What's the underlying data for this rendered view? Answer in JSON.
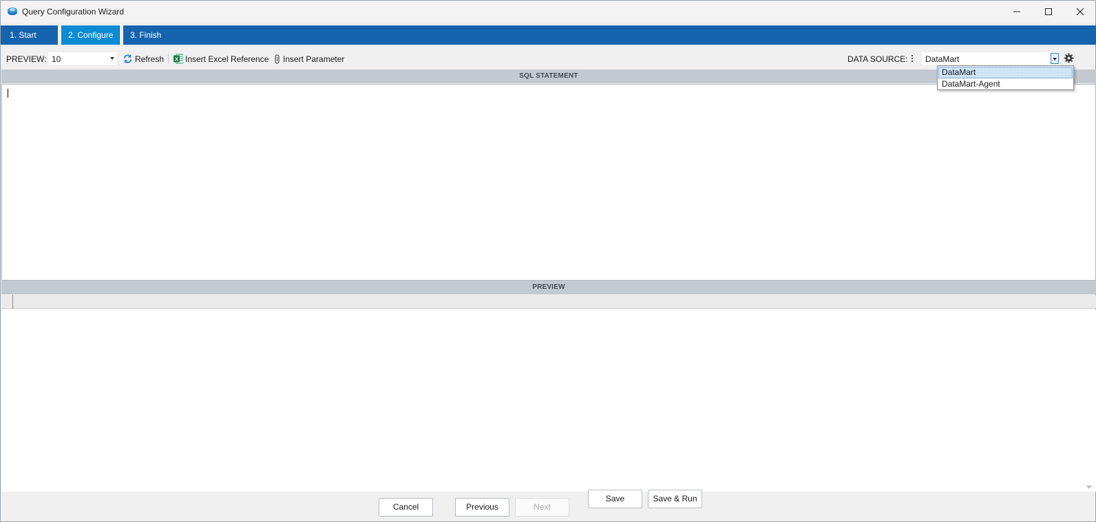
{
  "window": {
    "title": "Query Configuration Wizard",
    "icon": "app-logo-icon"
  },
  "wizard": {
    "steps": [
      {
        "label": "1. Start",
        "active": false
      },
      {
        "label": "2. Configure",
        "active": true
      },
      {
        "label": "3. Finish",
        "active": false
      }
    ],
    "colors": {
      "bar": "#1663ae",
      "active": "#0c8cd3"
    }
  },
  "toolbar": {
    "preview_label": "PREVIEW:",
    "preview_value": "10",
    "refresh_label": "Refresh",
    "insert_excel_label": "Insert Excel Reference",
    "insert_parameter_label": "Insert Parameter",
    "data_source_label": "DATA SOURCE:",
    "data_source_value": "DataMart"
  },
  "data_source_dropdown": {
    "options": [
      "DataMart",
      "DataMart-Agent"
    ],
    "selected": "DataMart"
  },
  "sections": {
    "sql_header": "SQL STATEMENT",
    "sql_text": "",
    "preview_header": "PREVIEW"
  },
  "footer": {
    "cancel": "Cancel",
    "previous": "Previous",
    "next": "Next",
    "save": "Save",
    "save_run": "Save & Run"
  }
}
